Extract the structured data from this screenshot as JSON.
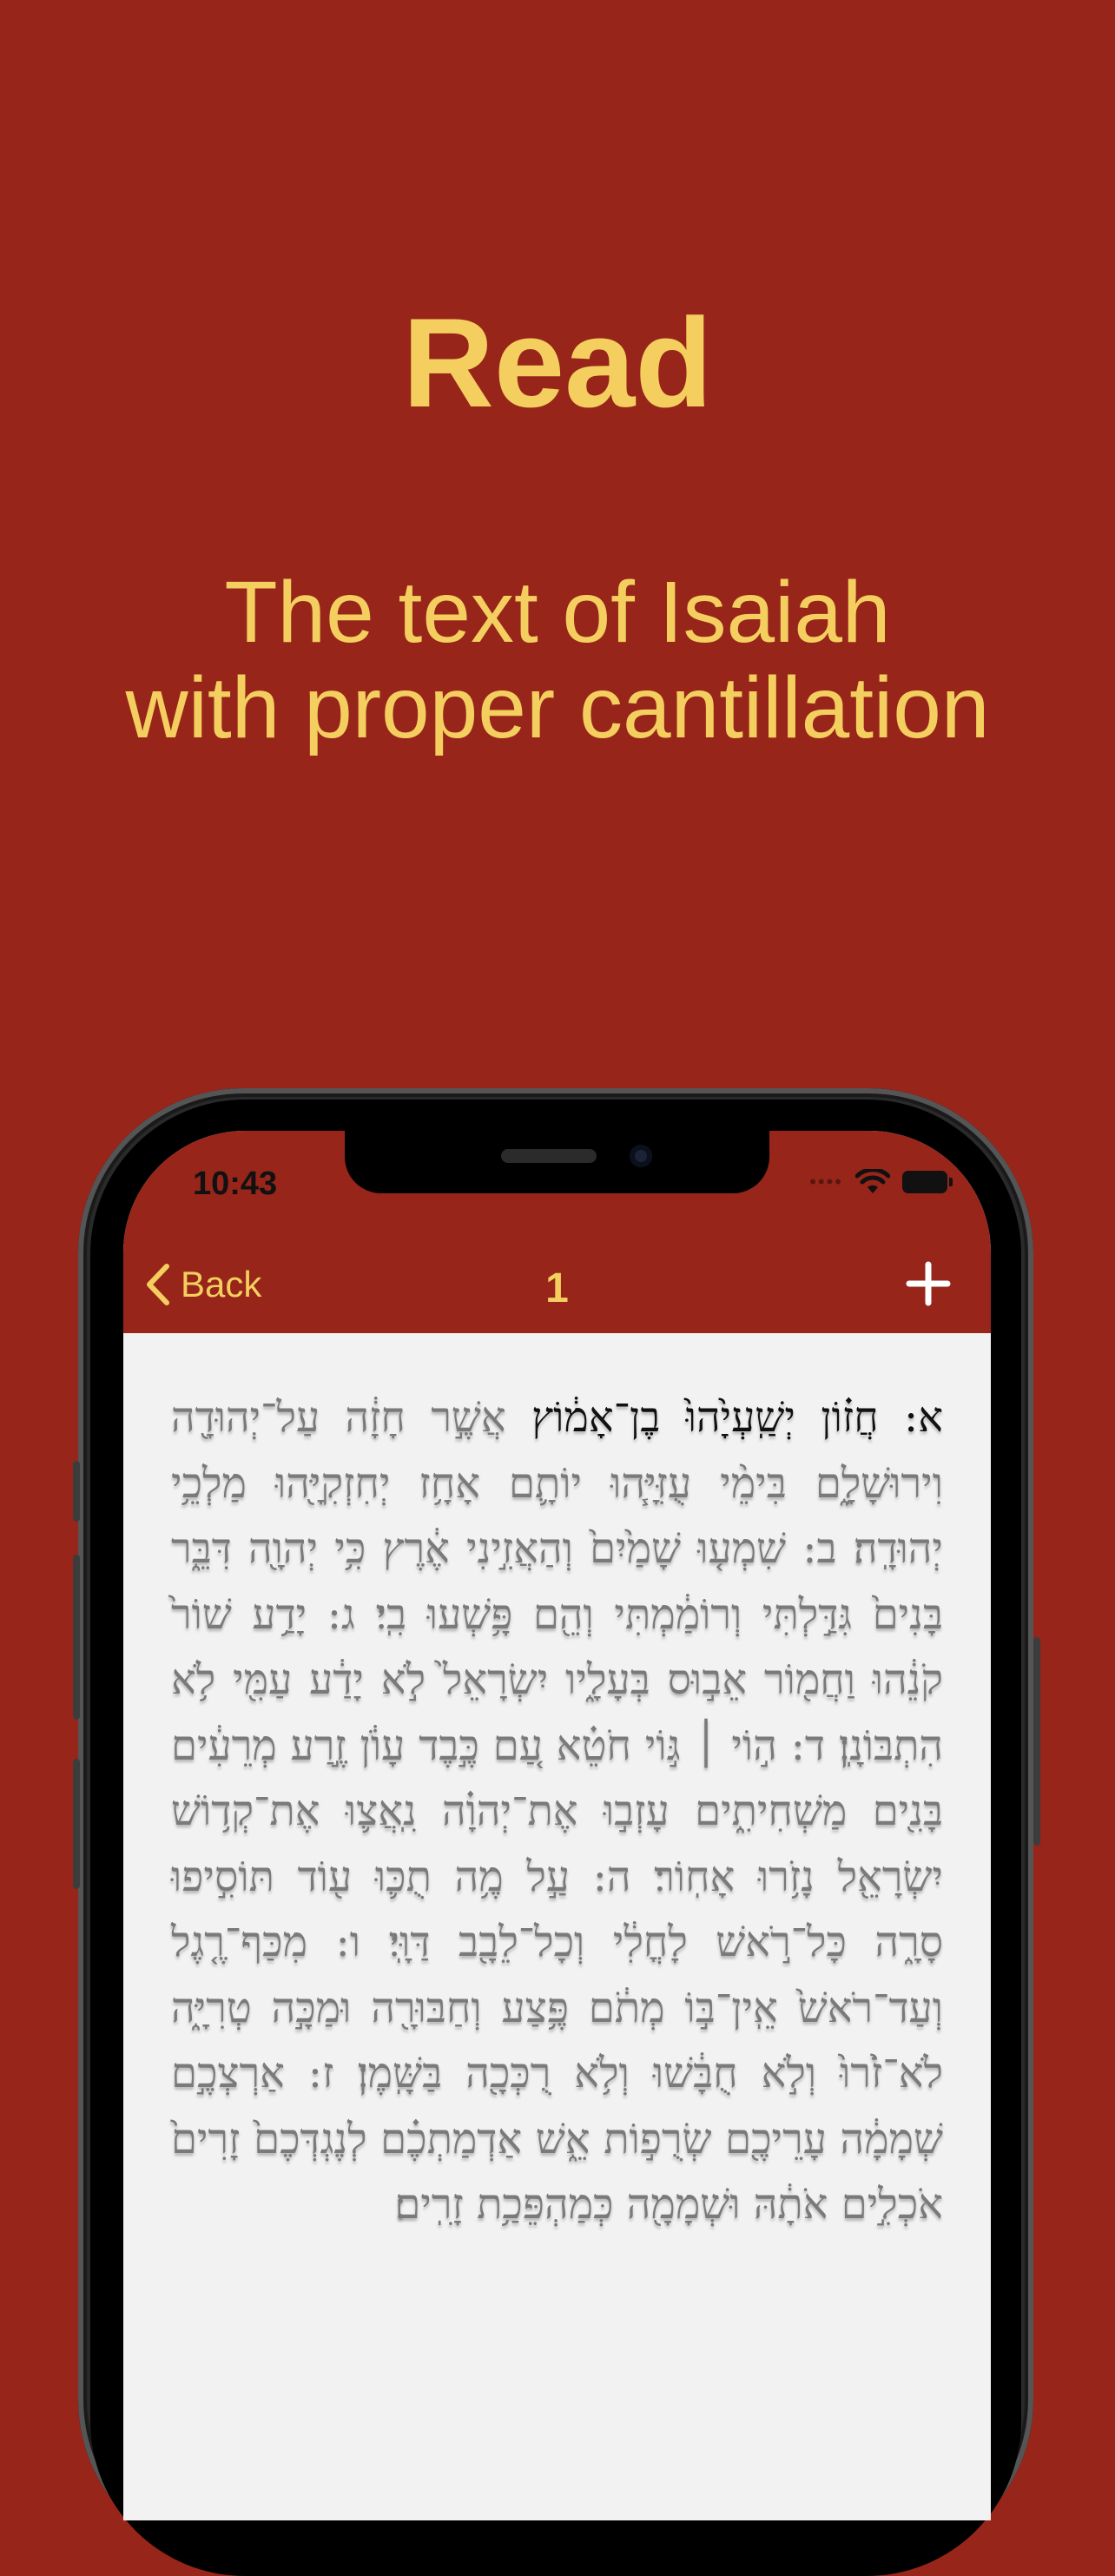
{
  "promo": {
    "headline": "Read",
    "subtitle_line1": "The text of Isaiah",
    "subtitle_line2": "with proper cantillation"
  },
  "colors": {
    "background": "#97251a",
    "accent_text": "#f4cf5f",
    "content_bg": "#f2f2f2"
  },
  "status_bar": {
    "time": "10:43",
    "icons": [
      "signal-dots-icon",
      "wifi-icon",
      "battery-icon"
    ]
  },
  "nav": {
    "back_label": "Back",
    "title": "1",
    "add_icon": "plus-icon"
  },
  "reader": {
    "active_segment": "א: חֲז֗וֹן יְשַֽׁעְיָ֙הוּ֙ בֶן־אָמ֔וֹץ",
    "rest_text": " אֲשֶׁ֣ר חָזָ֔ה עַל־יְהוּדָ֖ה וִירוּשָׁלָ֑͏ִם בִּימֵ֨י עֻזִּיָּ֧הוּ יוֹתָ֛ם אָחָ֥ז יְחִזְקִיָּ֖הוּ מַלְכֵ֥י יְהוּדָֽה׃ ב: שִׁמְע֤וּ שָׁמַ֙יִם֙ וְהַאֲזִ֣ינִי אֶ֔רֶץ כִּ֥י יְהוָ֖ה דִּבֵּ֑ר בָּנִים֙ גִּדַּ֣לְתִּי וְרוֹמַ֔מְתִּי וְהֵ֖ם פָּ֥שְׁעוּ בִֽי׃ ג: יָדַ֥ע שׁוֹר֙ קֹנֵ֔הוּ וַחֲמ֖וֹר אֵב֣וּס בְּעָלָ֑יו יִשְׂרָאֵל֙ לֹ֣א יָדַ֔ע עַמִּ֖י לֹ֥א הִתְבּוֹנָֽן׃ ד: ה֣וֹי ׀ גּ֣וֹי חֹטֵ֗א עַ֚ם כֶּ֣בֶד עָוֺ֔ן זֶ֣רַע מְרֵעִ֔ים בָּנִ֖ים מַשְׁחִיתִ֑ים עָזְב֣וּ אֶת־יְהוָ֗ה נִֽאֲצ֛וּ אֶת־קְד֥וֹשׁ יִשְׂרָאֵ֖ל נָזֹ֥רוּ אָחֽוֹר׃ ה: עַ֣ל מֶ֥ה תֻכּ֛וּ ע֖וֹד תּוֹסִ֣יפוּ סָרָ֑ה כָּל־רֹ֣אשׁ לָחֳלִ֔י וְכָל־לֵבָ֖ב דַּוָּֽי׃ ו: מִכַּף־רֶ֤גֶל וְעַד־רֹאשׁ֙ אֵֽין־בּ֣וֹ מְתֹ֔ם פֶּ֥צַע וְחַבּוּרָ֖ה וּמַכָּ֣ה טְרִיָּ֑ה לֹא־זֹ֙רוּ֙ וְלֹ֣א חֻבָּ֔שׁוּ וְלֹ֥א רֻכְּכָ֖ה בַּשָּֽׁמֶן׃ ז: אַרְצְכֶ֣ם שְׁמָמָ֔ה עָרֵיכֶ֖ם שְׂרֻפ֣וֹת אֵ֑שׁ אַדְמַתְכֶ֗ם לְנֶגְדְּכֶם֙ זָרִים֙ אֹכְלִ֣ים אֹתָ֔הּ וּשְׁמָמָ֖ה כְּמַהְפֵּכַ֥ת זָרִֽים׃"
  }
}
